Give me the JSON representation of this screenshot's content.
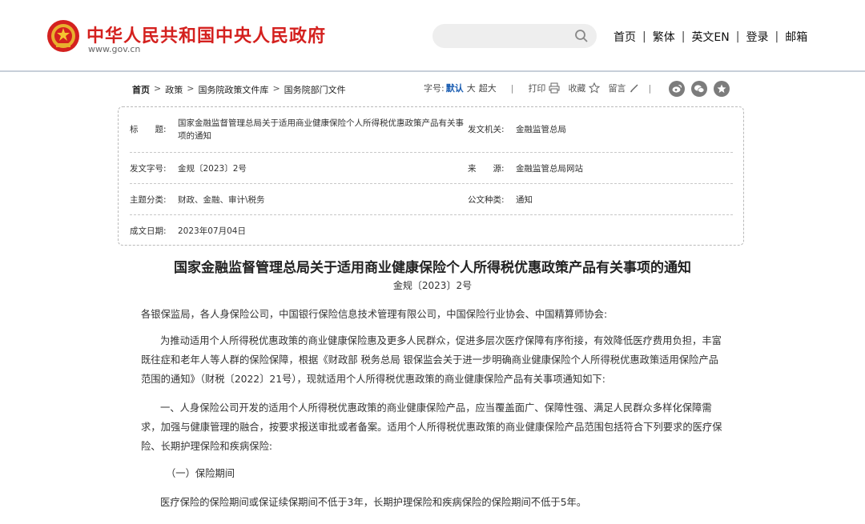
{
  "header": {
    "site_title": "中华人民共和国中央人民政府",
    "site_url": "www.gov.cn",
    "search_placeholder": "",
    "nav": [
      "首页",
      "繁体",
      "英文EN",
      "登录",
      "邮箱"
    ]
  },
  "breadcrumb": [
    "首页",
    "政策",
    "国务院政策文件库",
    "国务院部门文件"
  ],
  "toolbar": {
    "font_size_label": "字号:",
    "font_sizes": [
      "默认",
      "大",
      "超大"
    ],
    "print": "打印",
    "favorite": "收藏",
    "comment": "留言"
  },
  "info": {
    "title_label": "标　　题:",
    "title_value": "国家金融监督管理总局关于适用商业健康保险个人所得税优惠政策产品有关事项的通知",
    "issuer_label": "发文机关:",
    "issuer_value": "金融监管总局",
    "docno_label": "发文字号:",
    "docno_value": "金规〔2023〕2号",
    "source_label": "来　　源:",
    "source_value": "金融监管总局网站",
    "topic_label": "主题分类:",
    "topic_value": "财政、金融、审计\\税务",
    "doctype_label": "公文种类:",
    "doctype_value": "通知",
    "date_label": "成文日期:",
    "date_value": "2023年07月04日"
  },
  "article": {
    "title": "国家金融监督管理总局关于适用商业健康保险个人所得税优惠政策产品有关事项的通知",
    "doc_no": "金规〔2023〕2号",
    "p1": "各银保监局，各人身保险公司，中国银行保险信息技术管理有限公司，中国保险行业协会、中国精算师协会:",
    "p2": "为推动适用个人所得税优惠政策的商业健康保险惠及更多人民群众，促进多层次医疗保障有序衔接，有效降低医疗费用负担，丰富既往症和老年人等人群的保险保障，根据《财政部 税务总局 银保监会关于进一步明确商业健康保险个人所得税优惠政策适用保险产品范围的通知》（财税〔2022〕21号），现就适用个人所得税优惠政策的商业健康保险产品有关事项通知如下:",
    "p3": "一、人身保险公司开发的适用个人所得税优惠政策的商业健康保险产品，应当覆盖面广、保障性强、满足人民群众多样化保障需求，加强与健康管理的融合，按要求报送审批或者备案。适用个人所得税优惠政策的商业健康保险产品范围包括符合下列要求的医疗保险、长期护理保险和疾病保险:",
    "p4": "（一）保险期间",
    "p5": "医疗保险的保险期间或保证续保期间不低于3年，长期护理保险和疾病保险的保险期间不低于5年。"
  },
  "colors": {
    "brand_red": "#d4211f",
    "link_blue": "#1a5db2"
  }
}
